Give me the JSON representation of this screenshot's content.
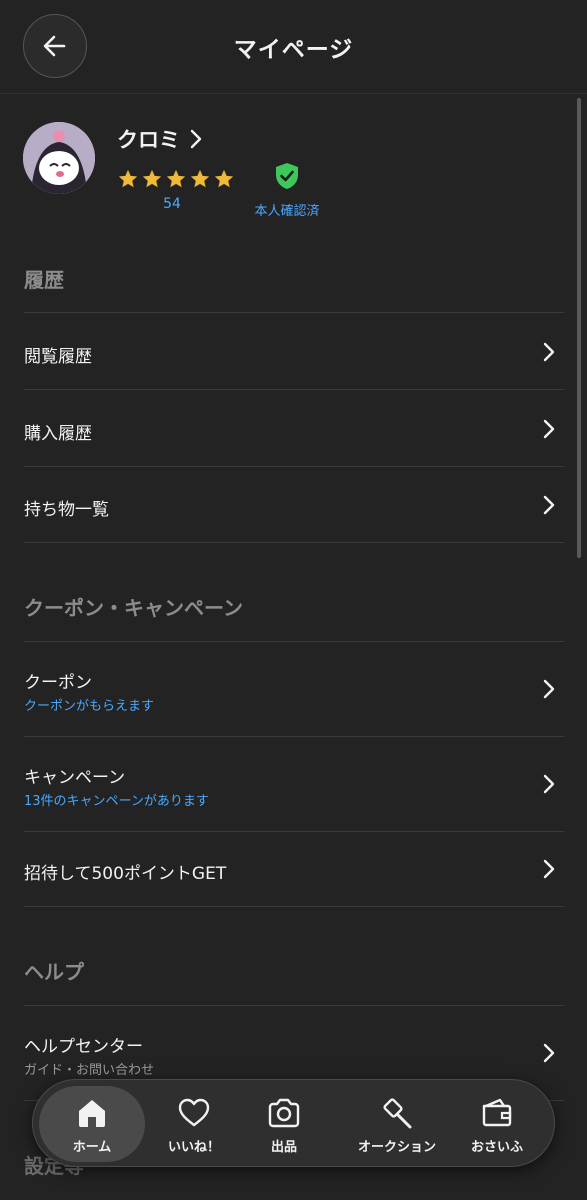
{
  "header": {
    "title": "マイページ"
  },
  "profile": {
    "name": "クロミ",
    "rating": 5,
    "review_count": "54",
    "verified_label": "本人確認済"
  },
  "sections": {
    "history": {
      "title": "履歴",
      "items": [
        {
          "label": "閲覧履歴"
        },
        {
          "label": "購入履歴"
        },
        {
          "label": "持ち物一覧"
        }
      ]
    },
    "coupon": {
      "title": "クーポン・キャンペーン",
      "items": [
        {
          "label": "クーポン",
          "sub": "クーポンがもらえます"
        },
        {
          "label": "キャンペーン",
          "sub": "13件のキャンペーンがあります"
        },
        {
          "label": "招待して500ポイントGET"
        }
      ]
    },
    "help": {
      "title": "ヘルプ",
      "items": [
        {
          "label": "ヘルプセンター",
          "sub": "ガイド・お問い合わせ"
        }
      ]
    },
    "settings": {
      "title": "設定等"
    }
  },
  "tabbar": {
    "tabs": [
      {
        "label": "ホーム",
        "icon": "home-icon",
        "active": true
      },
      {
        "label": "いいね！",
        "icon": "heart-icon"
      },
      {
        "label": "出品",
        "icon": "camera-icon"
      },
      {
        "label": "オークション",
        "icon": "gavel-icon"
      },
      {
        "label": "おさいふ",
        "icon": "wallet-icon"
      }
    ]
  },
  "colors": {
    "background": "#232323",
    "accent_blue": "#4aa8ff",
    "star": "#f0b93a",
    "verified_green": "#3ec85a"
  }
}
